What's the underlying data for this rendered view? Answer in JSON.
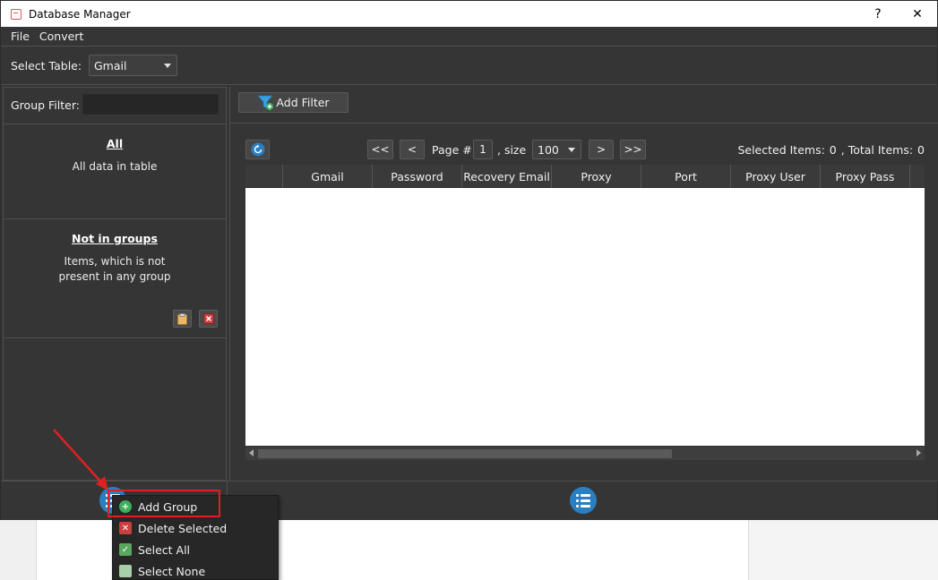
{
  "window": {
    "title": "Database Manager",
    "help_label": "?",
    "close_label": "✕"
  },
  "menu": {
    "items": [
      "File",
      "Convert"
    ]
  },
  "table_select": {
    "label": "Select Table:",
    "value": "Gmail"
  },
  "group_filter": {
    "label": "Group Filter:",
    "value": ""
  },
  "groups": [
    {
      "title": "All",
      "description": "All data in table"
    },
    {
      "title": "Not in groups",
      "description_line1": "Items, which is not",
      "description_line2": "present in any group"
    }
  ],
  "toolbar": {
    "add_filter_label": "Add Filter"
  },
  "pagination": {
    "first_label": "<<",
    "prev_label": "<",
    "page_label": "Page #",
    "page_value": "1",
    "size_label": ", size",
    "size_value": "100",
    "next_label": ">",
    "last_label": ">>",
    "selected_label": "Selected Items:",
    "selected_value": "0",
    "total_label": ", Total Items:",
    "total_value": "0"
  },
  "grid": {
    "columns": [
      "",
      "Gmail",
      "Password",
      "Recovery Email",
      "Proxy",
      "Port",
      "Proxy User",
      "Proxy Pass"
    ]
  },
  "context_menu": {
    "items": [
      {
        "label": "Add Group",
        "icon": "plus-circle-icon",
        "color": "#3cae5c"
      },
      {
        "label": "Delete Selected",
        "icon": "delete-icon",
        "color": "#c94040"
      },
      {
        "label": "Select All",
        "icon": "check-icon",
        "color": "#5aa860"
      },
      {
        "label": "Select None",
        "icon": "uncheck-icon",
        "color": "#a8d0a8"
      }
    ]
  },
  "colors": {
    "window_bg": "#353535",
    "accent_blue": "#2a7fc2",
    "annotation_red": "#e02020"
  }
}
